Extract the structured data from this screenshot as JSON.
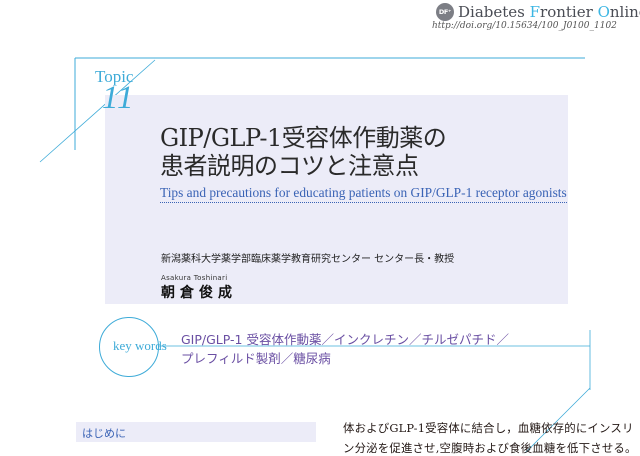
{
  "journal": {
    "logo_text": "DF⁺",
    "name_prefix": "Diabetes ",
    "name_accent": "F",
    "name_middle": "rontier ",
    "name_accent2": "O",
    "name_suffix": "nline",
    "doi": "http://doi.org/10.15634/100_J0100_1102"
  },
  "topic": {
    "label": "Topic",
    "number": "11"
  },
  "title": {
    "line1": "GIP/GLP-1受容体作動薬の",
    "line2": "患者説明のコツと注意点",
    "english": "Tips and precautions for educating patients on GIP/GLP-1 receptor agonists"
  },
  "author": {
    "affiliation": "新潟薬科大学薬学部臨床薬学教育研究センター センター長・教授",
    "romanized": "Asakura  Toshinari",
    "name": "朝倉俊成"
  },
  "keywords": {
    "label": "key words",
    "line1": "GIP/GLP-1 受容体作動薬／インクレチン／チルゼパチド／",
    "line2": "プレフィルド製剤／糖尿病"
  },
  "section": {
    "heading": "はじめに"
  },
  "body": {
    "line1": "体およびGLP-1受容体に結合し，血糖依存的にインスリ",
    "line2": "ン分泌を促進させ,空腹時および食後血糖を低下させる。"
  },
  "colors": {
    "accent_blue": "#3eabd8",
    "title_box": "#ececf8",
    "subtitle_blue": "#3a63b5",
    "keyword_purple": "#6a4fa3"
  }
}
